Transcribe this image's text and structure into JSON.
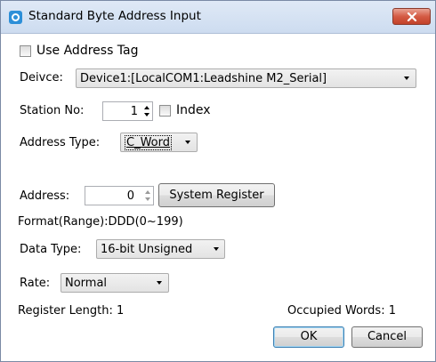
{
  "window": {
    "title": "Standard Byte Address Input",
    "app_icon": "cloud-app-icon",
    "close_icon": "close-icon"
  },
  "use_address_tag": {
    "label": "Use Address Tag",
    "checked": false
  },
  "device": {
    "label": "Deivce:",
    "value": "Device1:[LocalCOM1:Leadshine M2_Serial]"
  },
  "station": {
    "label": "Station No:",
    "value": "1",
    "index_label": "Index",
    "index_checked": false
  },
  "address_type": {
    "label": "Address Type:",
    "value": "C_Word"
  },
  "address": {
    "label": "Address:",
    "value": "0",
    "system_register_label": "System Register"
  },
  "format": {
    "text": "Format(Range):DDD(0~199)"
  },
  "data_type": {
    "label": "Data Type:",
    "value": "16-bit Unsigned"
  },
  "rate": {
    "label": "Rate:",
    "value": "Normal"
  },
  "footer": {
    "register_length": "Register Length: 1",
    "occupied_words": "Occupied Words: 1",
    "ok_label": "OK",
    "cancel_label": "Cancel"
  },
  "colors": {
    "title_bar": "#cddcf0",
    "close_button": "#c9442c",
    "default_button_border": "#3c7fb1"
  }
}
